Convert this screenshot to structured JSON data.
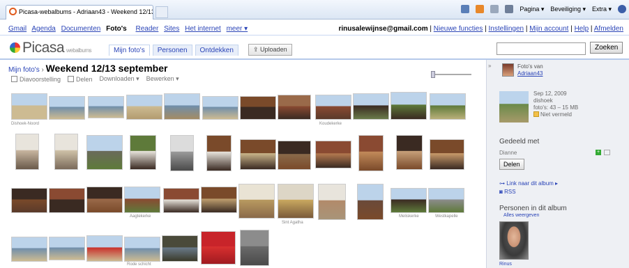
{
  "browser": {
    "tab_title": "Picasa-webalbums - Adriaan43 - Weekend 12/13 ...",
    "tools": [
      "Pagina ▾",
      "Beveiliging ▾",
      "Extra ▾"
    ]
  },
  "gbar": {
    "links": [
      "Gmail",
      "Agenda",
      "Documenten",
      "Foto's",
      "Reader",
      "Sites",
      "Het internet",
      "meer ▾"
    ],
    "current": "Foto's",
    "email": "rinusalewijnse@gmail.com",
    "right_links": [
      "Nieuwe functies",
      "Instellingen",
      "Mijn account",
      "Help",
      "Afmelden"
    ]
  },
  "header": {
    "logo": "Picasa",
    "logo_sub": "webalbums",
    "tabs": [
      "Mijn foto's",
      "Personen",
      "Ontdekken"
    ],
    "active_tab": "Mijn foto's",
    "upload_label": "Uploaden",
    "search_placeholder": "",
    "search_button": "Zoeken"
  },
  "album": {
    "crumb_link": "Mijn foto's",
    "separator": " › ",
    "title": "Weekend 12/13 september",
    "actions": [
      "Diavoorstelling",
      "Delen",
      "Downloaden ▾",
      "Bewerken ▾"
    ]
  },
  "photos": {
    "captions": [
      "Dishoek-Noord",
      "Koudekerke",
      "Aagtekerke",
      "Sint Agatha",
      "Meliskerke",
      "Westkapelle",
      "Rode schicht"
    ]
  },
  "sidebar": {
    "collapse": "»",
    "owner_prefix": "Foto's van",
    "owner": "Adriaan43",
    "date": "Sep 12, 2009",
    "place": "dishoek",
    "count": "foto's: 43 – 15 MB",
    "visibility": "Niet vermeld",
    "shared_title": "Gedeeld met",
    "shared_name": "Dianne",
    "share_button": "Delen",
    "link_album": "Link naar dit album ▸",
    "rss": "RSS",
    "persons_title": "Personen in dit album",
    "persons_all": "Alles weergeven",
    "person_name": "Rinus"
  }
}
